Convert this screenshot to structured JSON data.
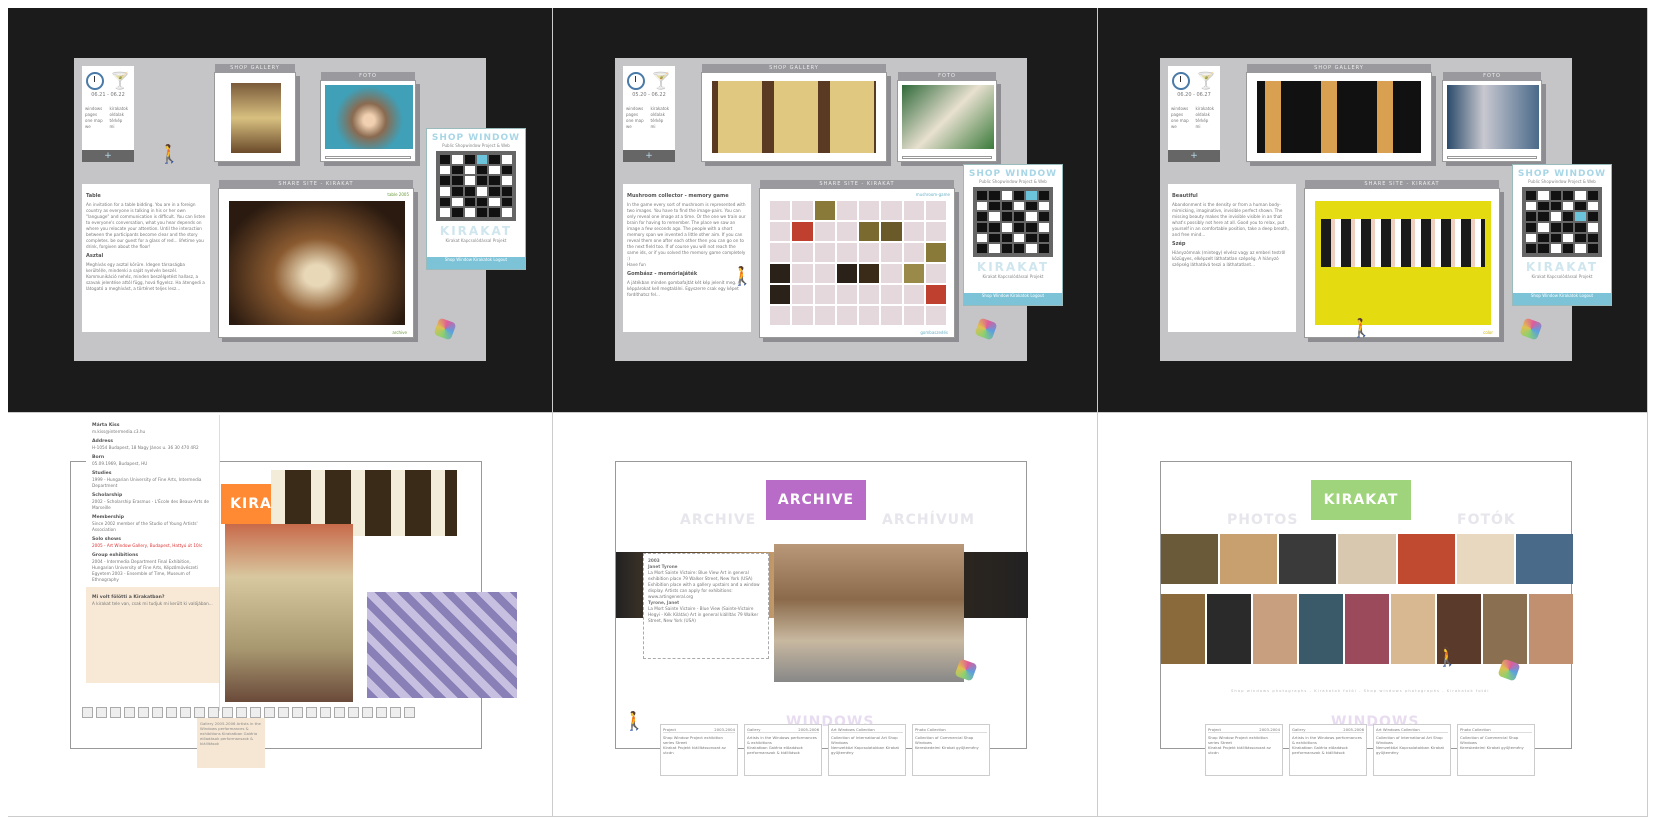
{
  "top_common": {
    "window_tabs": [
      [
        "windows",
        "kirakatok"
      ],
      [
        "pages",
        "oldalak"
      ],
      [
        "one map",
        "térkép"
      ],
      [
        "we",
        "mi"
      ]
    ],
    "plus": "+",
    "qr_title": "SHOP WINDOW",
    "qr_subtitle": "Public Shopwindow Project & Web",
    "qr_logo": "KIRAKAT",
    "qr_sub2": "Kirakat Kapcsolódással Projekt",
    "qr_foot": "Shop Window Kirakatok Logout"
  },
  "screens": [
    {
      "date": "06.21 - 06.22",
      "head1": "SHOP GALLERY",
      "head2": "FOTO",
      "head3": "SHARE SITE - KIRAKAT",
      "text_title": "Table",
      "text_body": "An invitation for a table bidding. You are in a foreign country as everyone is talking in his or her own \"language\" and communication is difficult. You can listen to everyone's conversation, what you hear depends on where you relocate your attention. Until the interaction between the participants become clear and the story completes. be our guest for a glass of red... lifetime you drink, forgiven about the floor!",
      "text_title2": "Asztal",
      "text_body2": "Meghívás egy asztal körüre. Idegen társaságba kerültél/e, mindenki a saját nyelvén beszél. Kommunikáció nehéz, minden beszélgetést hallasz, a szavak jelentése attól függ, hová figyelsz. Ha átengedi a látogató a meghívást, a történet teljes lesz...",
      "tag": "table 2005",
      "footer_tag": "archive"
    },
    {
      "date": "05.20 - 06.22",
      "head1": "SHOP GALLERY",
      "head2": "FOTO",
      "head3": "SHARE SITE - KIRAKAT",
      "text_title": "Mushroom collector - memory game",
      "text_body": "In the game every sort of mushroom is represented with two images. You have to find the image-pairs. You can only reveal one image at a time. Or the one we train our brain for having to remember. The place we saw an image a few seconds ago. The people with a short memory span we invented a little other aim. If you can reveal them one after each other then you can go on to the next field too. If of course you will not reach the same ids, or if you solved the memory game completely :)",
      "text_title2": "Gombász - memóriajáték",
      "text_body2": "A játékban minden gombafajtát két kép jelenít meg. A képpárokat kell megtalálni. Egyszerre csak egy képet fordíthatsz fel...",
      "extra_line": "Have fun",
      "tag": "mushroom-game",
      "footer_tag": "gombaszedés"
    },
    {
      "date": "06.20 - 06.27",
      "head1": "SHOP GALLERY",
      "head2": "FOTO",
      "head3": "SHARE SITE - KIRAKAT",
      "text_title": "Beautiful",
      "text_body": "Abandonment is the density or from a human body-mimicking, imaginative, invisible perfect shown. The missing beauty makes the invisible visible in an that what's possibly not here at all. Good you to relax, put yourself in an comfortable position, take a deep breath, and free mind...",
      "text_title2": "Szép",
      "text_body2": "Hiányzómnak (mintegy) elvész vagy az emberi testről közügyes, elképzelt láthatatlan szépség. A hiányzó szépség láthatóvá teszi a láthatatlant...",
      "tag": "",
      "footer_tag": "color"
    }
  ],
  "bottom_left": {
    "name_label": "Márta Kiss",
    "email": "m.kiss@intermedia.c3.hu",
    "address_label": "Address",
    "address": "H-1054 Budapest, 18 Nagy János u. 36 30 470 4R2",
    "born_label": "Born",
    "born": "05.09.1969, Budapest, HU",
    "studies_label": "Studies",
    "studies": "1999 - Hungarian University of Fine Arts, Intermedia Department",
    "scholarship_label": "Scholarship",
    "scholarship": "2002 - Scholarship Erasmus - L'École des Beaux-Arts de Marseille",
    "membership_label": "Membership",
    "membership": "Since 2002 member of the Studio of Young Artists' Association",
    "solo_label": "Solo shows",
    "solo": "2005 - Art Window Gallery, Budapest, Hattyú út 10/c",
    "group_label": "Group exhibitions",
    "group": "2004 - Intermedia Department Final Exhibition, Hungarian University of Fine Arts, Képzőművészeti Egyetem 2003 - Ensemble of Time, Museum of Ethnography",
    "question_label": "Mi volt fölötti a Kirakatban?",
    "question_body": "A kirakat tele van, csak mi tudjuk mi került ki valójában...",
    "banner": "KIRA",
    "gallery_tab": "Gallery 2005-2006 Artists in the Windows performances & exhibitions Kirakatban Galéria előadások performanszok & kiállítások"
  },
  "bottom_mid": {
    "banner": "ARCHIVE",
    "ghost_left": "ARCHIVE",
    "ghost_right": "ARCHÍVUM",
    "ghost_bottom": "WINDOWS",
    "popup_year": "2003",
    "popup_title": "Janet Tyrone",
    "popup_body": "La Mort Sainte Victoire: Blue View Art in general exhibition place 79 Walker Street, New York (USA) Exhibition place with a gallery upstairs and a window display. Artists can apply for exhibitions: www.artingeneral.org",
    "popup_title2": "Tyrone, Janet",
    "popup_body2": "La Mort Sainte Victoire - Blue View (Sainte-Victoire Hegyi - Kék Kilátás) Art in general kiállítás 79 Walker Street, New York (USA)"
  },
  "bottom_right": {
    "banner": "KIRAKAT",
    "ghost_left": "PHOTOS",
    "ghost_right": "FOTÓK",
    "ghost_bottom": "WINDOWS",
    "caption": "Shop windows photographs - Kirakatok fotói - Shop windows photographs - Kirakatok fotói"
  },
  "nav_cards": [
    {
      "title": "Project",
      "years": "2003-2004",
      "body": "Shop Window Project exhibition series Street",
      "hu": "Kirakat Projekt kiállítássorozat az utcán"
    },
    {
      "title": "Gallery",
      "years": "2005-2006",
      "body": "Artists in the Windows performances & exhibitions",
      "hu": "Kirakatban Galéria előadások performanszok & kiállítások"
    },
    {
      "title": "Art Windows Collection",
      "years": "",
      "body": "Collection of International Art Shop Windows",
      "hu": "Nemzetközi Kapcsolatokban Kirakat gyűjtemény"
    },
    {
      "title": "Photo Collection",
      "years": "",
      "body": "Collection of Commercial Shop Windows",
      "hu": "Kereskedelmi Kirakat gyűjtemény"
    }
  ],
  "colors": {
    "dark_bg": "#1b1b1b",
    "accent_blue": "#7cc3d8",
    "accent_purple": "#b86bc7",
    "accent_green": "#9fd47c",
    "accent_orange": "#ff8a33",
    "nav_square_colors": [
      "#cfe6ee",
      "#f0c49c",
      "#c8a8e0",
      "#bfe0a8"
    ]
  }
}
